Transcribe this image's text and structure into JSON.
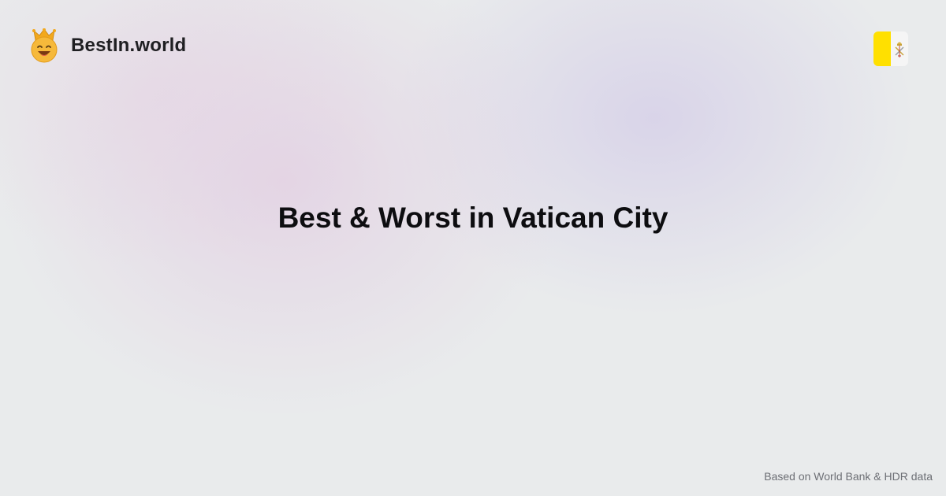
{
  "brand": {
    "name": "BestIn.world",
    "logo_icon": "crown-smiley-icon"
  },
  "flag": {
    "icon": "vatican-flag-icon",
    "colors": {
      "yellow": "#ffe000",
      "white": "#f5f5f5"
    }
  },
  "title": "Best & Worst in Vatican City",
  "footer": {
    "source": "Based on World Bank & HDR data"
  }
}
